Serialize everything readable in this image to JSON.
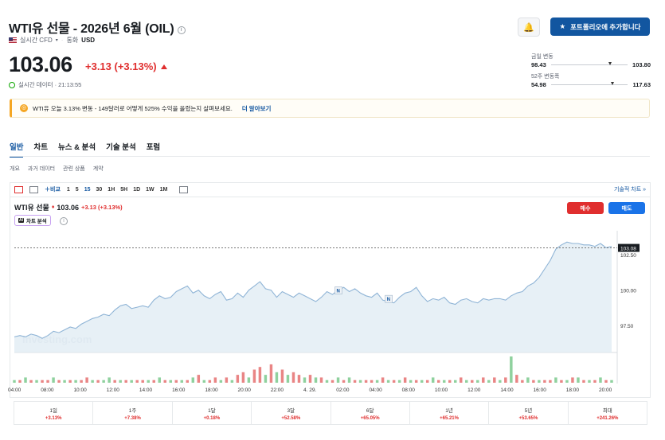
{
  "header": {
    "title": "WTI유 선물 - 2026년 6월 (OIL)",
    "realtime_label": "실시간 CFD",
    "currency_label": "통화",
    "currency": "USD",
    "price": "103.06",
    "change": "+3.13 (+3.13%)",
    "realtime_data": "실시간 데이터 · 21:13:55",
    "add_portfolio": "포트폴리오에 추가합니다"
  },
  "ranges": [
    {
      "label": "금일 변동",
      "low": "98.43",
      "high": "103.80",
      "marker": 0.75
    },
    {
      "label": "52주 변동폭",
      "low": "54.98",
      "high": "117.63",
      "marker": 0.78
    }
  ],
  "alert": {
    "text": "WTI유 오늘 3.13% 변동 - 149달러로 어떻게 525% 수익을 올렸는지 살펴보세요.",
    "more": "더 알아보기"
  },
  "tabs": [
    "일반",
    "차트",
    "뉴스 & 분석",
    "기술 분석",
    "포럼"
  ],
  "subtabs": [
    "개요",
    "과거 데이터",
    "관련 상품",
    "계약"
  ],
  "toolbar": {
    "compare": "비교",
    "timeframes": [
      "1",
      "5",
      "15",
      "30",
      "1H",
      "5H",
      "1D",
      "1W",
      "1M"
    ],
    "selected": "15",
    "advanced": "기술적 차트 »"
  },
  "chart_header": {
    "name": "WTI유 선물",
    "price": "103.06",
    "change": "+3.13 (+3.13%)",
    "ai_label": "차트 분석",
    "ai_badge": "AI",
    "buy": "매수",
    "sell": "매도",
    "watermark": "Investing.com",
    "news_marker": "N"
  },
  "chart_data": {
    "type": "area",
    "ylim": [
      95.6,
      104.2
    ],
    "yticks": [
      "102.50",
      "100.00",
      "97.50"
    ],
    "last_label": "103.08",
    "xticks": [
      "04:00",
      "08:00",
      "10:00",
      "12:00",
      "14:00",
      "16:00",
      "18:00",
      "20:00",
      "22:00",
      "4. 29.",
      "02:00",
      "04:00",
      "08:00",
      "10:00",
      "12:00",
      "14:00",
      "16:00",
      "18:00",
      "20:00"
    ],
    "prices": [
      96.7,
      96.8,
      96.7,
      96.9,
      96.8,
      96.6,
      96.8,
      97.1,
      97.0,
      97.2,
      97.4,
      97.3,
      97.6,
      97.8,
      98.0,
      98.1,
      98.3,
      98.2,
      98.6,
      98.9,
      99.0,
      98.7,
      98.8,
      98.9,
      98.8,
      99.3,
      99.6,
      99.4,
      99.5,
      99.9,
      100.1,
      100.3,
      99.8,
      100.0,
      99.6,
      99.4,
      99.7,
      99.9,
      99.3,
      99.4,
      99.8,
      99.5,
      100.0,
      100.3,
      100.6,
      100.1,
      100.0,
      99.5,
      99.9,
      99.7,
      99.5,
      99.8,
      99.6,
      99.4,
      99.2,
      99.5,
      99.9,
      99.7,
      100.0,
      100.2,
      99.9,
      100.1,
      99.8,
      99.6,
      99.5,
      99.8,
      99.3,
      99.2,
      99.1,
      99.5,
      99.8,
      99.9,
      100.2,
      99.6,
      99.2,
      99.4,
      99.3,
      99.5,
      99.1,
      99.0,
      99.3,
      99.4,
      99.2,
      99.1,
      99.4,
      99.3,
      99.4,
      99.4,
      99.3,
      99.6,
      99.8,
      99.9,
      100.3,
      100.5,
      100.9,
      101.5,
      102.1,
      102.9,
      103.2,
      103.4,
      103.3,
      103.3,
      103.2,
      103.2,
      103.1,
      103.3,
      103.0,
      103.1
    ],
    "volumes": [
      1,
      1,
      2,
      1,
      1,
      1,
      1,
      2,
      1,
      1,
      1,
      1,
      1,
      2,
      1,
      1,
      1,
      2,
      1,
      1,
      1,
      1,
      1,
      1,
      1,
      1,
      2,
      1,
      1,
      1,
      1,
      1,
      2,
      3,
      1,
      1,
      2,
      1,
      2,
      1,
      3,
      4,
      2,
      5,
      6,
      3,
      7,
      4,
      5,
      3,
      4,
      3,
      2,
      3,
      2,
      2,
      1,
      1,
      2,
      1,
      2,
      1,
      1,
      1,
      1,
      1,
      2,
      1,
      1,
      1,
      2,
      1,
      1,
      1,
      1,
      2,
      1,
      1,
      1,
      1,
      2,
      1,
      1,
      1,
      2,
      1,
      2,
      1,
      2,
      10,
      3,
      1,
      2,
      1,
      1,
      1,
      1,
      2,
      1,
      1,
      2,
      2,
      1,
      1,
      1,
      2,
      1,
      1
    ],
    "volume_colors": [
      "g",
      "r",
      "g",
      "r",
      "g",
      "r",
      "r",
      "g",
      "r",
      "g",
      "r",
      "g",
      "r",
      "r",
      "g",
      "r",
      "g",
      "g",
      "r",
      "g",
      "r",
      "g",
      "r",
      "r",
      "g",
      "r",
      "g",
      "r",
      "g",
      "r",
      "g",
      "r",
      "g",
      "r",
      "g",
      "r",
      "r",
      "g",
      "r",
      "g",
      "r",
      "r",
      "g",
      "r",
      "r",
      "g",
      "r",
      "g",
      "r",
      "g",
      "r",
      "r",
      "g",
      "r",
      "g",
      "r",
      "g",
      "r",
      "g",
      "r",
      "g",
      "r",
      "g",
      "r",
      "r",
      "g",
      "r",
      "g",
      "r",
      "g",
      "r",
      "g",
      "r",
      "g",
      "r",
      "g",
      "r",
      "g",
      "r",
      "g",
      "r",
      "g",
      "r",
      "g",
      "r",
      "g",
      "r",
      "g",
      "r",
      "g",
      "r",
      "r",
      "g",
      "r",
      "g",
      "r",
      "r",
      "g",
      "r",
      "g",
      "r",
      "g",
      "r",
      "g",
      "r",
      "g",
      "r",
      "g"
    ]
  },
  "performance": [
    {
      "label": "1일",
      "value": "+3.13%"
    },
    {
      "label": "1주",
      "value": "+7.38%"
    },
    {
      "label": "1달",
      "value": "+0.18%"
    },
    {
      "label": "3달",
      "value": "+52.58%"
    },
    {
      "label": "6달",
      "value": "+65.05%"
    },
    {
      "label": "1년",
      "value": "+65.21%"
    },
    {
      "label": "5년",
      "value": "+53.65%"
    },
    {
      "label": "최대",
      "value": "+241.26%"
    }
  ],
  "colors": {
    "accent": "#1256a0",
    "down_red": "#e02e2e",
    "line": "#8fb4d6",
    "area": "#e3edf5",
    "vol_green": "#8fd19e",
    "vol_red": "#e98585"
  }
}
